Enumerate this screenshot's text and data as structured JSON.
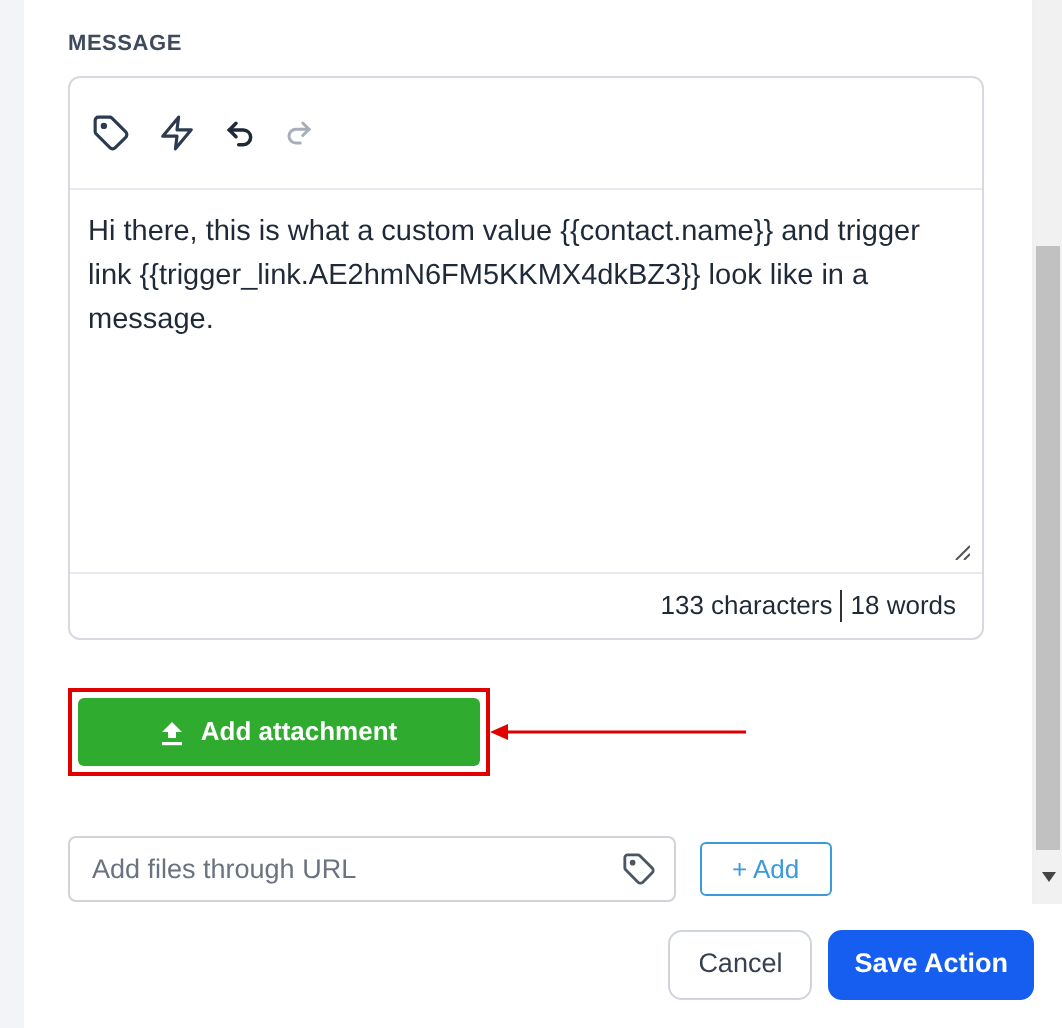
{
  "section_label": "MESSAGE",
  "message": {
    "value": "Hi there, this is what a custom value {{contact.name}} and trigger link {{trigger_link.AE2hmN6FM5KKMX4dkBZ3}} look like in a message.",
    "characters": "133 characters",
    "words": "18 words",
    "redo_disabled": true
  },
  "attachment_button": "Add attachment",
  "url_field": {
    "placeholder": "Add files through URL"
  },
  "add_button": "+ Add",
  "footer_buttons": [
    {
      "label": "Cancel",
      "kind": "secondary"
    },
    {
      "label": "Save Action",
      "kind": "primary"
    }
  ]
}
